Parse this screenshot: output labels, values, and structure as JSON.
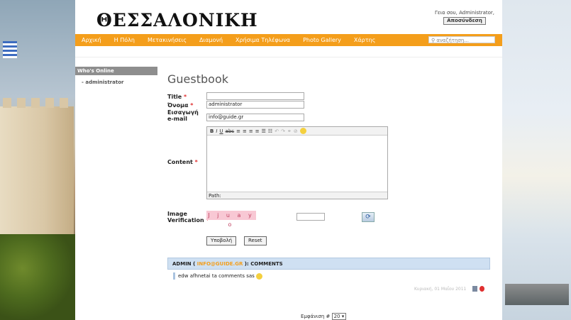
{
  "site": {
    "logo": "ΘΕΣΣΑΛΟΝΙΚΗ",
    "greeting": "Γεια σου, Administrator,",
    "logout": "Αποσύνδεση"
  },
  "nav": {
    "items": [
      "Αρχική",
      "Η Πόλη",
      "Μετακινήσεις",
      "Διαμονή",
      "Χρήσιμα Τηλέφωνα",
      "Photo Gallery",
      "Χάρτης"
    ],
    "search_placeholder": "αναζήτηση..."
  },
  "sidebar": {
    "title": "Who's Online",
    "users": [
      "administrator"
    ]
  },
  "form": {
    "heading": "Guestbook",
    "title_label": "Title",
    "title_value": "",
    "name_label": "Όνομα",
    "name_value": "administrator",
    "email_label1": "Εισαγωγή",
    "email_label2": "e-mail",
    "email_value": "info@guide.gr",
    "content_label": "Content",
    "path_label": "Path:",
    "captcha_label1": "Image",
    "captcha_label2": "Verification",
    "captcha_text": "J j u a y o",
    "submit": "Υποβολή",
    "reset": "Reset",
    "required_mark": "*"
  },
  "comments": {
    "header_prefix": "ADMIN (",
    "header_email": "INFO@GUIDE.GR",
    "header_suffix": "): COMMENTS",
    "text": "edw afhnetai ta comments sas",
    "date": "Κυριακή, 01 Μαΐου 2011"
  },
  "footer": {
    "display_label": "Εμφάνιση #",
    "display_value": "20"
  },
  "colors": {
    "accent": "#f49e1b",
    "sidebar_head": "#8e8e8e",
    "comments_bg": "#cfe0f2"
  }
}
